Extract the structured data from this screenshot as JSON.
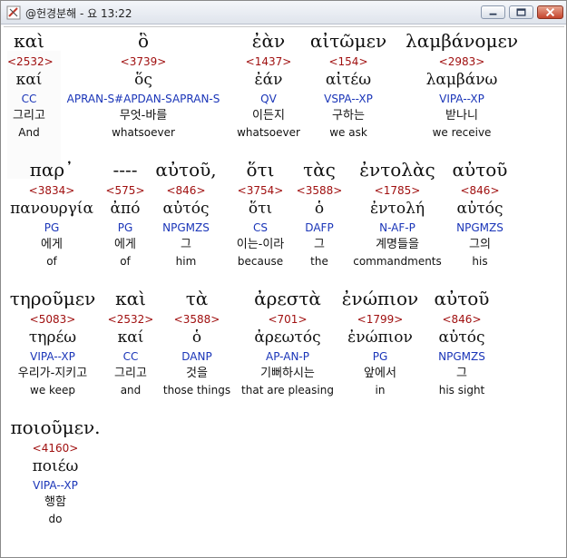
{
  "window": {
    "title": "@헌경분해 - 요 13:22",
    "minimize_label": "minimize",
    "maximize_label": "maximize",
    "close_label": "close"
  },
  "colors": {
    "strong": "#a01010",
    "parsing": "#1a35b8",
    "text": "#111111"
  },
  "rows": [
    {
      "words": [
        {
          "word": "καὶ",
          "strong": "<2532>",
          "lemma": "καί",
          "parse": "CC",
          "korean": "그리고",
          "english": "And"
        },
        {
          "word": "ὃ",
          "strong": "<3739>",
          "lemma": "ὅς",
          "parse": "APRAN-S#APDAN-SAPRAN-S",
          "korean": "무엇-바를",
          "english": "whatsoever"
        },
        {
          "word": "ἐὰν",
          "strong": "<1437>",
          "lemma": "ἐάν",
          "parse": "QV",
          "korean": "이든지",
          "english": "whatsoever"
        },
        {
          "word": "αἰτῶμεν",
          "strong": "<154>",
          "lemma": "αἰτέω",
          "parse": "VSPA--XP",
          "korean": "구하는",
          "english": "we ask"
        },
        {
          "word": "λαμβάνομεν",
          "strong": "<2983>",
          "lemma": "λαμβάνω",
          "parse": "VIPA--XP",
          "korean": "받나니",
          "english": "we receive"
        }
      ]
    },
    {
      "words": [
        {
          "word": "παρ᾽",
          "strong": "<3834>",
          "lemma": "πανουργία",
          "parse": "PG",
          "korean": "에게",
          "english": "of"
        },
        {
          "word": "----",
          "strong": "<575>",
          "lemma": "ἀπό",
          "parse": "PG",
          "korean": "에게",
          "english": "of"
        },
        {
          "word": "αὐτοῦ,",
          "strong": "<846>",
          "lemma": "αὐτός",
          "parse": "NPGMZS",
          "korean": "그",
          "english": "him"
        },
        {
          "word": "ὅτι",
          "strong": "<3754>",
          "lemma": "ὅτι",
          "parse": "CS",
          "korean": "이는-이라",
          "english": "because"
        },
        {
          "word": "τὰς",
          "strong": "<3588>",
          "lemma": "ὁ",
          "parse": "DAFP",
          "korean": "그",
          "english": "the"
        },
        {
          "word": "ἐντολὰς",
          "strong": "<1785>",
          "lemma": "ἐντολή",
          "parse": "N-AF-P",
          "korean": "계명들을",
          "english": "commandments"
        },
        {
          "word": "αὐτοῦ",
          "strong": "<846>",
          "lemma": "αὐτός",
          "parse": "NPGMZS",
          "korean": "그의",
          "english": "his"
        }
      ]
    },
    {
      "words": [
        {
          "word": "τηροῦμεν",
          "strong": "<5083>",
          "lemma": "τηρέω",
          "parse": "VIPA--XP",
          "korean": "우리가-지키고",
          "english": "we keep"
        },
        {
          "word": "καὶ",
          "strong": "<2532>",
          "lemma": "καί",
          "parse": "CC",
          "korean": "그리고",
          "english": "and"
        },
        {
          "word": "τὰ",
          "strong": "<3588>",
          "lemma": "ὁ",
          "parse": "DANP",
          "korean": "것을",
          "english": "those things"
        },
        {
          "word": "ἀρεστὰ",
          "strong": "<701>",
          "lemma": "ἀρεωτός",
          "parse": "AP-AN-P",
          "korean": "기뻐하시는",
          "english": "that are pleasing"
        },
        {
          "word": "ἐνώπιον",
          "strong": "<1799>",
          "lemma": "ἐνώπιον",
          "parse": "PG",
          "korean": "앞에서",
          "english": "in"
        },
        {
          "word": "αὐτοῦ",
          "strong": "<846>",
          "lemma": "αὐτός",
          "parse": "NPGMZS",
          "korean": "그",
          "english": "his sight"
        }
      ]
    },
    {
      "words": [
        {
          "word": "ποιοῦμεν.",
          "strong": "<4160>",
          "lemma": "ποιέω",
          "parse": "VIPA--XP",
          "korean": "행함",
          "english": "do"
        }
      ]
    }
  ]
}
